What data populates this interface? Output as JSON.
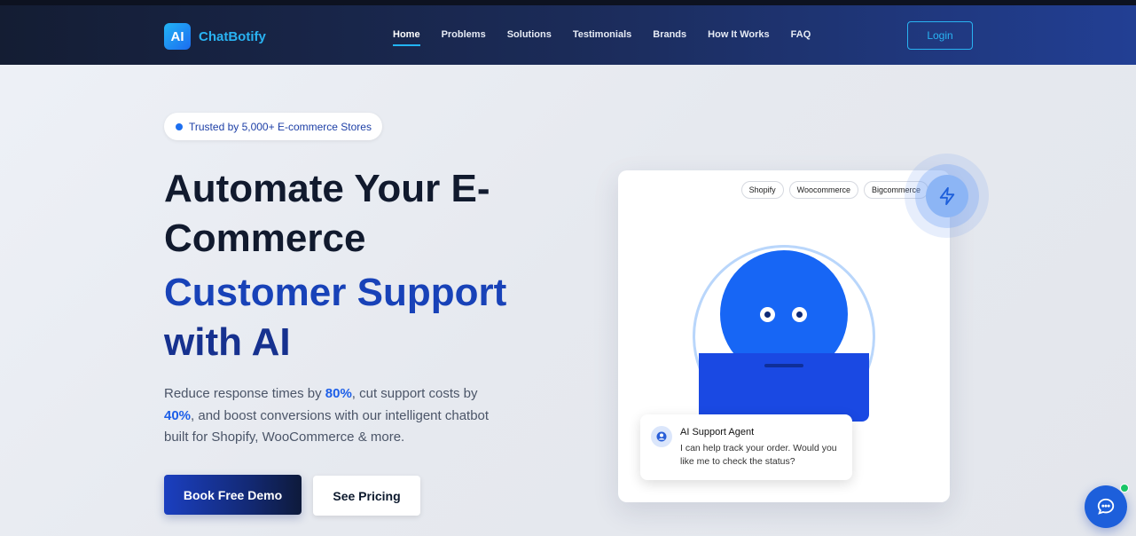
{
  "brand": {
    "badge": "AI",
    "name": "ChatBotify"
  },
  "nav": {
    "links": [
      "Home",
      "Problems",
      "Solutions",
      "Testimonials",
      "Brands",
      "How It Works",
      "FAQ"
    ],
    "active": "Home",
    "login_label": "Login"
  },
  "hero": {
    "badge_text": "Trusted by 5,000+ E-commerce Stores",
    "title_line1": "Automate Your E-",
    "title_line2": "Commerce",
    "highlight_line1": "Customer Support",
    "highlight_line2": "with AI",
    "desc_part1": "Reduce response times by ",
    "desc_stat1": "80%",
    "desc_part2": ", cut support costs by ",
    "desc_stat2": "40%",
    "desc_part3": ", and boost conversions with our intelligent chatbot built for Shopify, WooCommerce & more.",
    "primary_button": "Book Free Demo",
    "secondary_button": "See Pricing"
  },
  "card": {
    "platforms": [
      "Shopify",
      "Woocommerce",
      "Bigcommerce"
    ],
    "chat_name": "AI Support Agent",
    "chat_message": "I can help track your order. Would you like me to check the status?"
  },
  "colors": {
    "accent": "#1d6ff0",
    "brand_cyan": "#29b3f2",
    "online": "#19c566"
  },
  "icons": {
    "bolt": "lightning-icon",
    "user": "user-icon",
    "chat": "chat-bubble-icon"
  }
}
